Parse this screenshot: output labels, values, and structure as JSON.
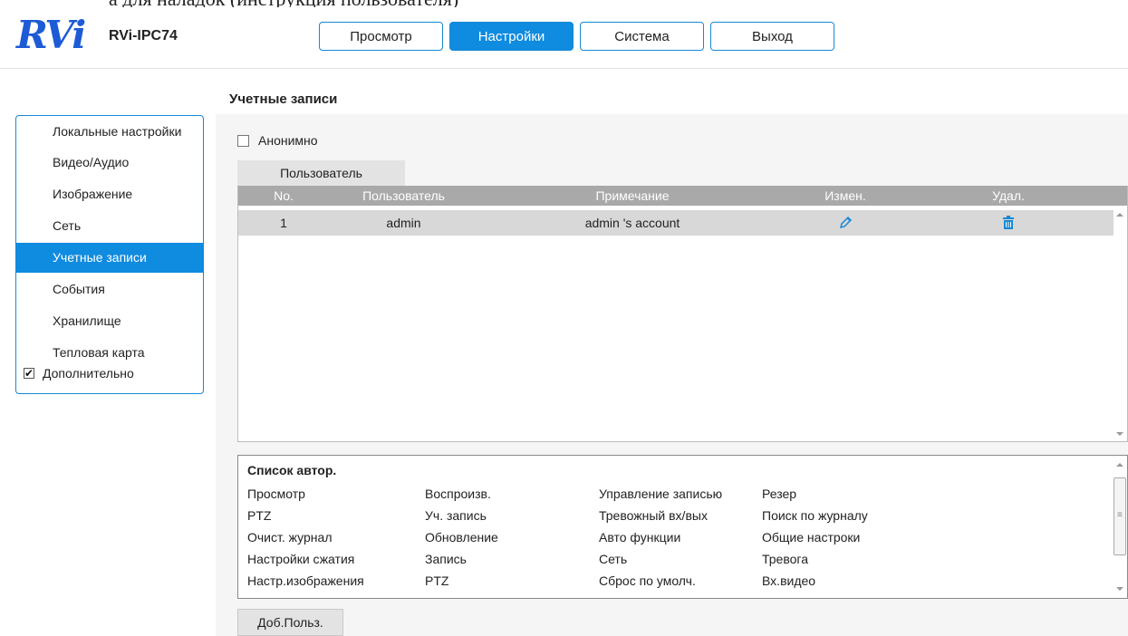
{
  "doc_crop_text": "а для наладок (инструкция пользователя)",
  "header": {
    "logo_text": "RVi",
    "model": "RVi-IPC74",
    "nav": [
      {
        "label": "Просмотр",
        "active": false
      },
      {
        "label": "Настройки",
        "active": true
      },
      {
        "label": "Система",
        "active": false
      },
      {
        "label": "Выход",
        "active": false
      }
    ],
    "accent_color": "#0f8be0"
  },
  "sidebar": {
    "items": [
      {
        "label": "Локальные настройки"
      },
      {
        "label": "Видео/Аудио"
      },
      {
        "label": "Изображение"
      },
      {
        "label": "Сеть"
      },
      {
        "label": "Учетные записи",
        "active": true
      },
      {
        "label": "События"
      },
      {
        "label": "Хранилище"
      },
      {
        "label": "Тепловая карта"
      }
    ],
    "advanced": {
      "label": "Дополнительно",
      "checked": true
    }
  },
  "page": {
    "title": "Учетные записи",
    "anonymous": {
      "label": "Анонимно",
      "checked": false
    },
    "tab": "Пользователь"
  },
  "users_table": {
    "headers": {
      "no": "No.",
      "user": "Пользователь",
      "note": "Примечание",
      "edit": "Измен.",
      "delete": "Удал."
    },
    "rows": [
      {
        "no": "1",
        "user": "admin",
        "note": "admin 's account",
        "edit_icon": "pencil-icon",
        "delete_icon": "trash-icon"
      }
    ]
  },
  "permissions": {
    "title": "Список автор.",
    "rows": [
      [
        "Просмотр",
        "Воспроизв.",
        "Управление записью",
        "Резер"
      ],
      [
        "PTZ",
        "Уч. запись",
        "Тревожный вх/вых",
        "Поиск по журналу"
      ],
      [
        "Очист. журнал",
        "Обновление",
        "Авто функции",
        "Общие настроки"
      ],
      [
        "Настройки сжатия",
        "Запись",
        "Сеть",
        "Тревога"
      ],
      [
        "Настр.изображения",
        "PTZ",
        "Сброс по умолч.",
        "Вх.видео"
      ]
    ]
  },
  "add_button": "Доб.Польз."
}
